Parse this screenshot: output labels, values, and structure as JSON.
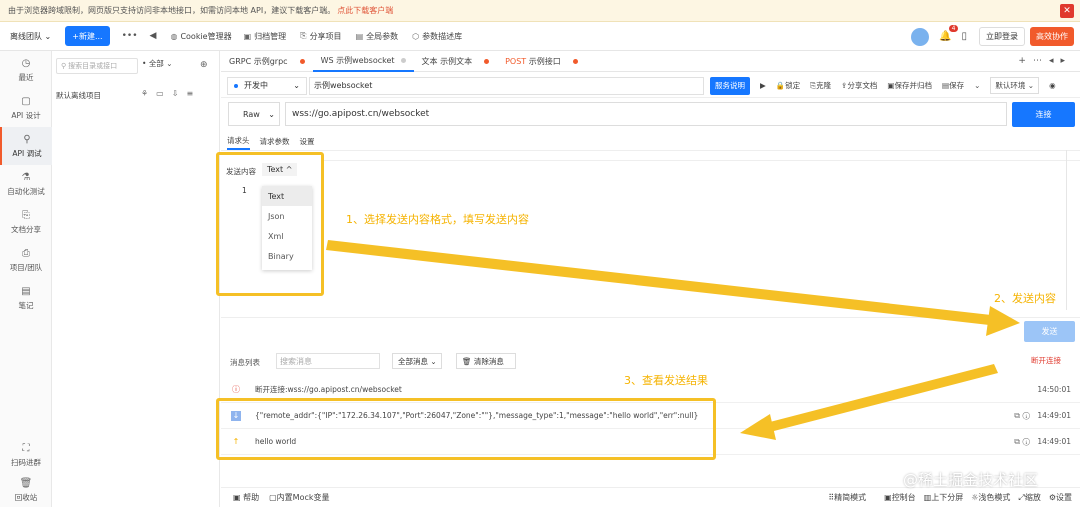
{
  "banner": {
    "text": "由于浏览器跨域限制，网页版只支持访问非本地接口，如需访问本地 API，建议下载客户端。",
    "download_link": "点此下载客户端"
  },
  "topbar": {
    "team": "离线团队 ⌄",
    "new_button": "+新建...",
    "cookie_manager": "Cookie管理器",
    "items": [
      "归档管理",
      "分享项目",
      "全局参数",
      "参数描述库"
    ],
    "notification_count": "4",
    "login": "立即登录",
    "cooperate": "高效协作"
  },
  "sidebar": {
    "items": [
      {
        "label": "最近",
        "icon": "clock-icon"
      },
      {
        "label": "API 设计",
        "icon": "doc-icon"
      },
      {
        "label": "API 调试",
        "icon": "debug-icon"
      },
      {
        "label": "自动化测试",
        "icon": "auto-test-icon"
      },
      {
        "label": "文档分享",
        "icon": "share-icon"
      },
      {
        "label": "项目/团队",
        "icon": "team-icon"
      },
      {
        "label": "笔记",
        "icon": "note-icon"
      }
    ],
    "bottom": [
      {
        "label": "扫码进群",
        "icon": "qrcode-icon"
      },
      {
        "label": "回收站",
        "icon": "trash-icon"
      }
    ]
  },
  "tree": {
    "search_placeholder": "搜索目录或接口",
    "filter": "全部",
    "project": "默认离线项目"
  },
  "tabs": [
    {
      "prefix": "GRPC",
      "name": "示例grpc",
      "active": false
    },
    {
      "prefix": "WS",
      "name": "示例websocket",
      "active": true
    },
    {
      "prefix": "文本",
      "name": "示例文本",
      "active": false
    },
    {
      "prefix": "POST",
      "name": "示例接口",
      "active": false
    }
  ],
  "request": {
    "env_status": "开发中",
    "name": "示例websocket",
    "service_desc": "服务说明",
    "actions": [
      "锁定",
      "克隆",
      "分享文档",
      "保存并归档",
      "保存"
    ],
    "env": "默认环境",
    "method": "Raw",
    "url": "wss://go.apipost.cn/websocket",
    "connect": "连接",
    "subtabs": [
      "请求头",
      "请求参数",
      "设置"
    ]
  },
  "editor": {
    "send_label": "发送内容",
    "type": "Text ^",
    "line_number": "1",
    "type_options": [
      "Text",
      "Json",
      "Xml",
      "Binary"
    ],
    "send_button": "发送"
  },
  "messages": {
    "label": "消息列表",
    "search_placeholder": "搜索消息",
    "filter": "全部消息",
    "clear": "清除消息",
    "disconnect": "断开连接",
    "rows": [
      {
        "text": "断开连接:wss://go.apipost.cn/websocket",
        "time": "14:50:01",
        "kind": "info"
      },
      {
        "text": "{\"remote_addr\":{\"IP\":\"172.26.34.107\",\"Port\":26047,\"Zone\":\"\"},\"message_type\":1,\"message\":\"hello world\",\"err\":null}",
        "time": "14:49:01",
        "kind": "received"
      },
      {
        "text": "hello world",
        "time": "14:49:01",
        "kind": "sent"
      }
    ]
  },
  "annotations": {
    "step1": "1、选择发送内容格式，填写发送内容",
    "step2": "2、发送内容",
    "step3": "3、查看发送结果",
    "color": "#f5c026"
  },
  "footer": {
    "left": [
      "帮助",
      "内置Mock变量"
    ],
    "right": [
      "精简模式",
      "控制台",
      "上下分屏",
      "浅色模式",
      "缩放",
      "设置"
    ]
  },
  "watermark": "@稀土掘金技术社区",
  "colors": {
    "accent": "#1677ff",
    "brand": "#f15a2b",
    "danger": "#e0392d"
  }
}
